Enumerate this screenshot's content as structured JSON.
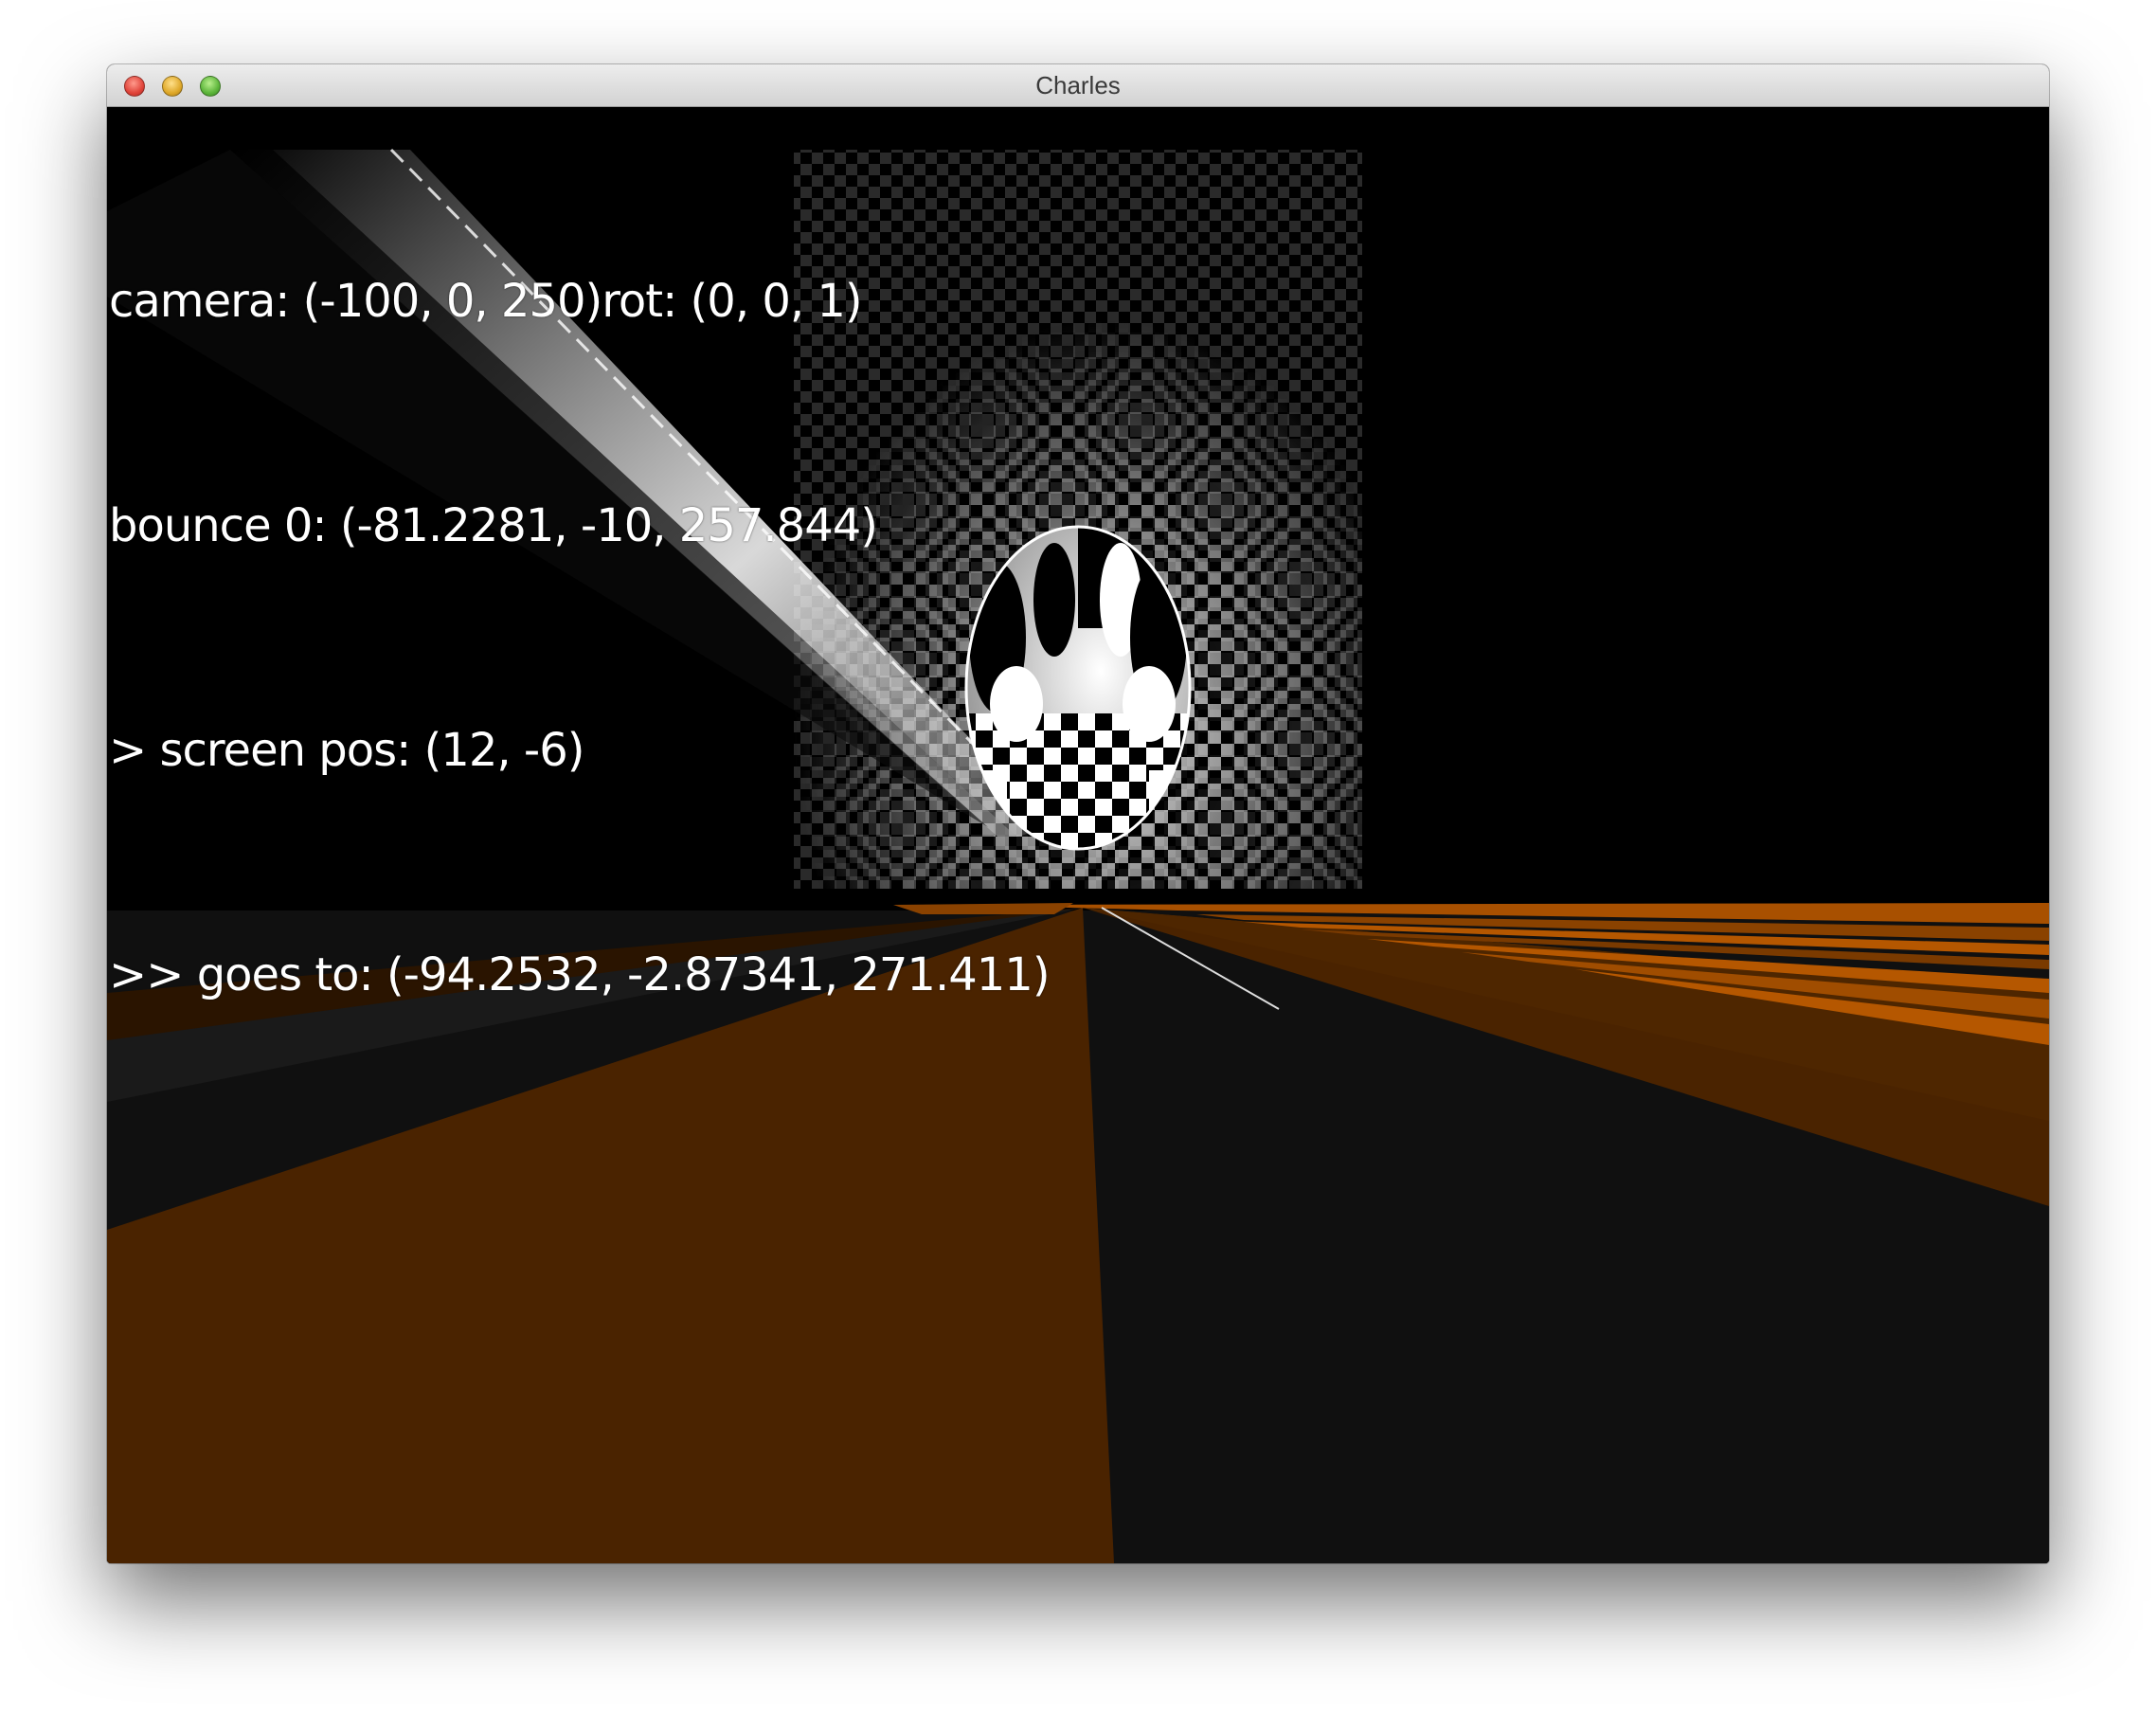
{
  "window": {
    "title": "Charles"
  },
  "debug_overlay": {
    "camera_line": "camera: (-100, 0, 250)rot: (0, 0, 1)",
    "bounce_line": "bounce 0: (-81.2281, -10, 257.844)",
    "screen_pos_line": "> screen pos: (12, -6)",
    "goes_to_line": ">> goes to: (-94.2532, -2.87341, 271.411)"
  },
  "colors": {
    "floor_orange": "#4a2300",
    "floor_dark": "#101010",
    "highlight_orange": "#b55700",
    "checker_light": "#ffffff",
    "checker_dark": "#000000"
  }
}
